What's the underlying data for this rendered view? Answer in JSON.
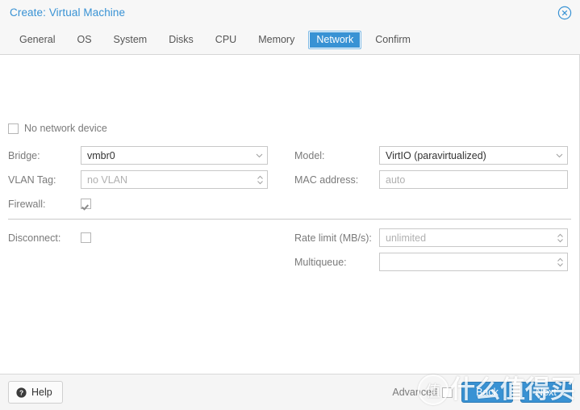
{
  "window": {
    "title": "Create: Virtual Machine",
    "close_icon": "close-circle-icon",
    "accent_color": "#3892d4"
  },
  "tabs": [
    {
      "label": "General",
      "active": false
    },
    {
      "label": "OS",
      "active": false
    },
    {
      "label": "System",
      "active": false
    },
    {
      "label": "Disks",
      "active": false
    },
    {
      "label": "CPU",
      "active": false
    },
    {
      "label": "Memory",
      "active": false
    },
    {
      "label": "Network",
      "active": true
    },
    {
      "label": "Confirm",
      "active": false
    }
  ],
  "form": {
    "no_network_device": {
      "label": "No network device",
      "checked": false
    },
    "left": [
      {
        "label": "Bridge:",
        "value": "vmbr0",
        "placeholder": "",
        "control": "combobox",
        "is_placeholder": false
      },
      {
        "label": "VLAN Tag:",
        "value": "no VLAN",
        "placeholder": "no VLAN",
        "control": "spinner",
        "is_placeholder": true
      },
      {
        "label": "Firewall:",
        "value": "",
        "control": "checkbox",
        "checked": true
      }
    ],
    "right": [
      {
        "label": "Model:",
        "value": "VirtIO (paravirtualized)",
        "placeholder": "",
        "control": "combobox",
        "is_placeholder": false
      },
      {
        "label": "MAC address:",
        "value": "auto",
        "placeholder": "auto",
        "control": "text",
        "is_placeholder": true
      }
    ],
    "lower_left": [
      {
        "label": "Disconnect:",
        "value": "",
        "control": "checkbox",
        "checked": false
      }
    ],
    "lower_right": [
      {
        "label": "Rate limit (MB/s):",
        "value": "unlimited",
        "placeholder": "unlimited",
        "control": "spinner",
        "is_placeholder": true
      },
      {
        "label": "Multiqueue:",
        "value": "",
        "placeholder": "",
        "control": "spinner",
        "is_placeholder": true
      }
    ]
  },
  "footer": {
    "help_label": "Help",
    "help_icon": "question-circle-icon",
    "advanced_label": "Advanced",
    "advanced_checked": false,
    "back_label": "Back",
    "next_label": "Next"
  },
  "watermark": {
    "badge": "值",
    "text": "什么值得买"
  }
}
